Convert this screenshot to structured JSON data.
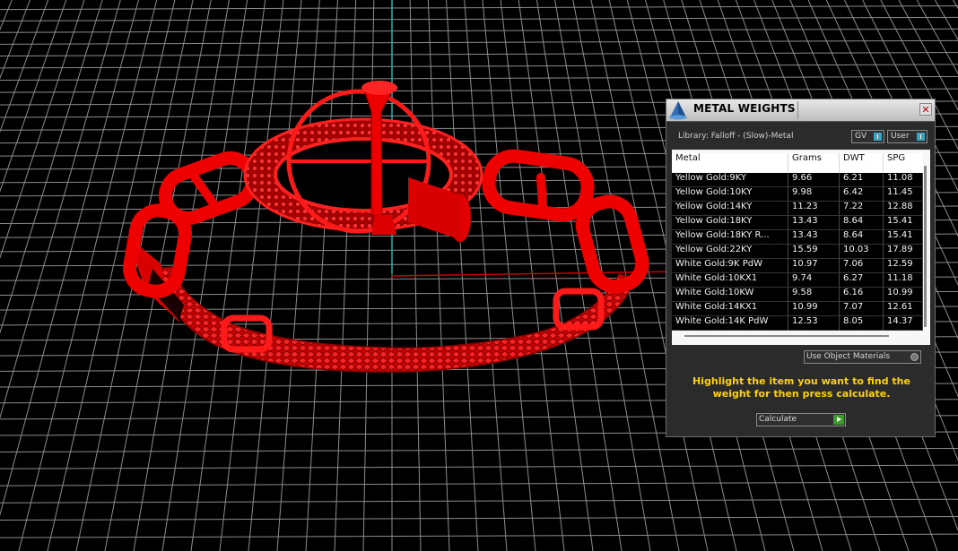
{
  "panel": {
    "title": "METAL WEIGHTS",
    "close_glyph": "✕",
    "library_label": "Library: Falloff - (Slow)-Metal",
    "toggles": {
      "gv": "GV",
      "user": "User"
    },
    "table": {
      "headers": [
        "Metal",
        "Grams",
        "DWT",
        "SPG"
      ],
      "rows": [
        [
          "Yellow Gold:9KY",
          "9.66",
          "6.21",
          "11.08"
        ],
        [
          "Yellow Gold:10KY",
          "9.98",
          "6.42",
          "11.45"
        ],
        [
          "Yellow Gold:14KY",
          "11.23",
          "7.22",
          "12.88"
        ],
        [
          "Yellow Gold:18KY",
          "13.43",
          "8.64",
          "15.41"
        ],
        [
          "Yellow Gold:18KY R...",
          "13.43",
          "8.64",
          "15.41"
        ],
        [
          "Yellow Gold:22KY",
          "15.59",
          "10.03",
          "17.89"
        ],
        [
          "White Gold:9K PdW",
          "10.97",
          "7.06",
          "12.59"
        ],
        [
          "White Gold:10KX1",
          "9.74",
          "6.27",
          "11.18"
        ],
        [
          "White Gold:10KW",
          "9.58",
          "6.16",
          "10.99"
        ],
        [
          "White Gold:14KX1",
          "10.99",
          "7.07",
          "12.61"
        ],
        [
          "White Gold:14K PdW",
          "12.53",
          "8.05",
          "14.37"
        ]
      ]
    },
    "use_materials_label": "Use Object Materials",
    "instruction": "Highlight the item you want to find the weight for then press calculate.",
    "calculate_label": "Calculate"
  },
  "icons": {
    "app_logo": "rhino-pyramid-icon",
    "close": "close-icon",
    "go": "play-arrow-icon"
  },
  "colors": {
    "model": "#e30000",
    "instruction_text": "#ffd200",
    "grid_line": "#8a8a8a",
    "axis_x": "#c00000",
    "axis_z": "#19b3b3"
  }
}
